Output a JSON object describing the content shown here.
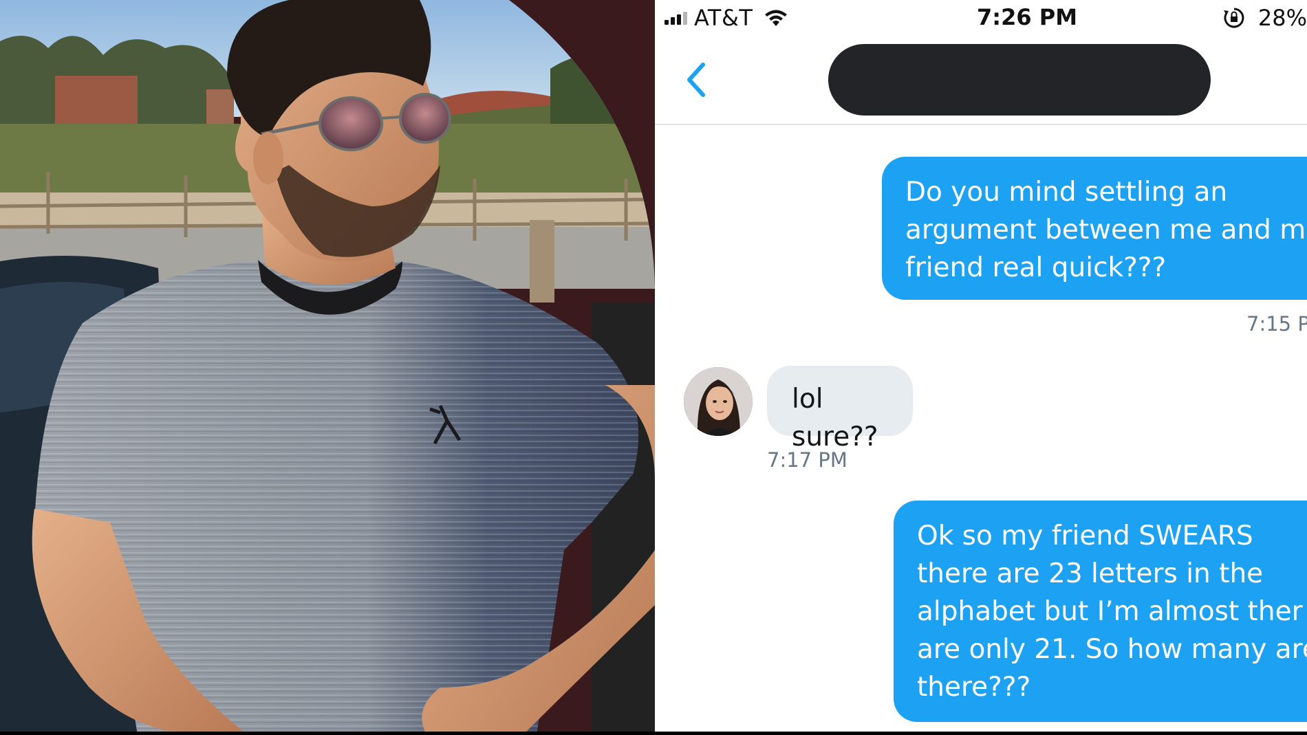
{
  "status_bar": {
    "carrier": "AT&T",
    "time": "7:26 PM",
    "battery": "28%",
    "icons": [
      "signal-icon",
      "wifi-icon",
      "rotation-lock-icon"
    ]
  },
  "nav": {
    "back_icon": "chevron-left-icon",
    "accent_color": "#1da1f2"
  },
  "messages": [
    {
      "direction": "sent",
      "text": "Do you mind settling an\nargument between me and m\nfriend real quick???",
      "time": "7:15 P"
    },
    {
      "direction": "received",
      "text": "lol sure??",
      "time": "7:17 PM"
    },
    {
      "direction": "sent",
      "text": "Ok so my friend SWEARS\nthere are 23 letters in the\nalphabet but I’m almost ther\nare only 21. So how many are\nthere???"
    }
  ],
  "colors": {
    "sent_bubble": "#1da1f2",
    "received_bubble": "#e6ecf0",
    "redaction": "#222427"
  }
}
